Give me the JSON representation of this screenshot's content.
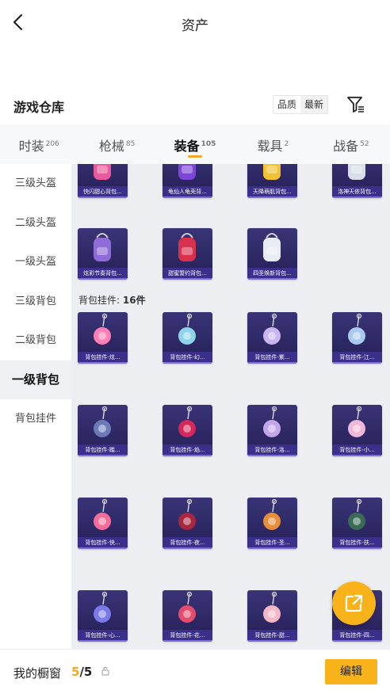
{
  "header": {
    "title": "资产"
  },
  "section": {
    "title": "游戏仓库",
    "sort_quality": "品质",
    "sort_latest": "最新"
  },
  "tabs": [
    {
      "label": "时装",
      "count": "206"
    },
    {
      "label": "枪械",
      "count": "85"
    },
    {
      "label": "装备",
      "count": "105"
    },
    {
      "label": "载具",
      "count": "2"
    },
    {
      "label": "战备",
      "count": "52"
    }
  ],
  "sidebar": {
    "items": [
      {
        "label": "三级头盔"
      },
      {
        "label": "二级头盔"
      },
      {
        "label": "一级头盔"
      },
      {
        "label": "三级背包"
      },
      {
        "label": "二级背包"
      },
      {
        "label": "一级背包"
      },
      {
        "label": "背包挂件"
      }
    ]
  },
  "backpacks": [
    {
      "label": "快闪甜心背包..."
    },
    {
      "label": "龟仙人龟壳背..."
    },
    {
      "label": "天降萌肌背包..."
    },
    {
      "label": "洛神天依背包..."
    },
    {
      "label": "炫彩节奏背包..."
    },
    {
      "label": "甜蜜誓约背包..."
    },
    {
      "label": "四圣焕新背包..."
    }
  ],
  "pendant_group": {
    "label": "背包挂件:",
    "count": "16件"
  },
  "pendants": [
    {
      "label": "背包挂件-炫..."
    },
    {
      "label": "背包挂件-幻..."
    },
    {
      "label": "背包挂件-紫..."
    },
    {
      "label": "背包挂件-江..."
    },
    {
      "label": "背包挂件-踏..."
    },
    {
      "label": "背包挂件-焰..."
    },
    {
      "label": "背包挂件-洛..."
    },
    {
      "label": "背包挂件-小..."
    },
    {
      "label": "背包挂件-快..."
    },
    {
      "label": "背包挂件-夜..."
    },
    {
      "label": "背包挂件-圣..."
    },
    {
      "label": "背包挂件-扶..."
    },
    {
      "label": "背包挂件-心..."
    },
    {
      "label": "背包挂件-花..."
    },
    {
      "label": "背包挂件-甜..."
    },
    {
      "label": "背包挂件-四..."
    }
  ],
  "bottom": {
    "label": "我的橱窗",
    "current": "5",
    "total": "/5",
    "edit": "编辑"
  },
  "colors": {
    "accent": "#f8b21a",
    "card": "#2b2660",
    "grid_bg": "#eceef2"
  }
}
